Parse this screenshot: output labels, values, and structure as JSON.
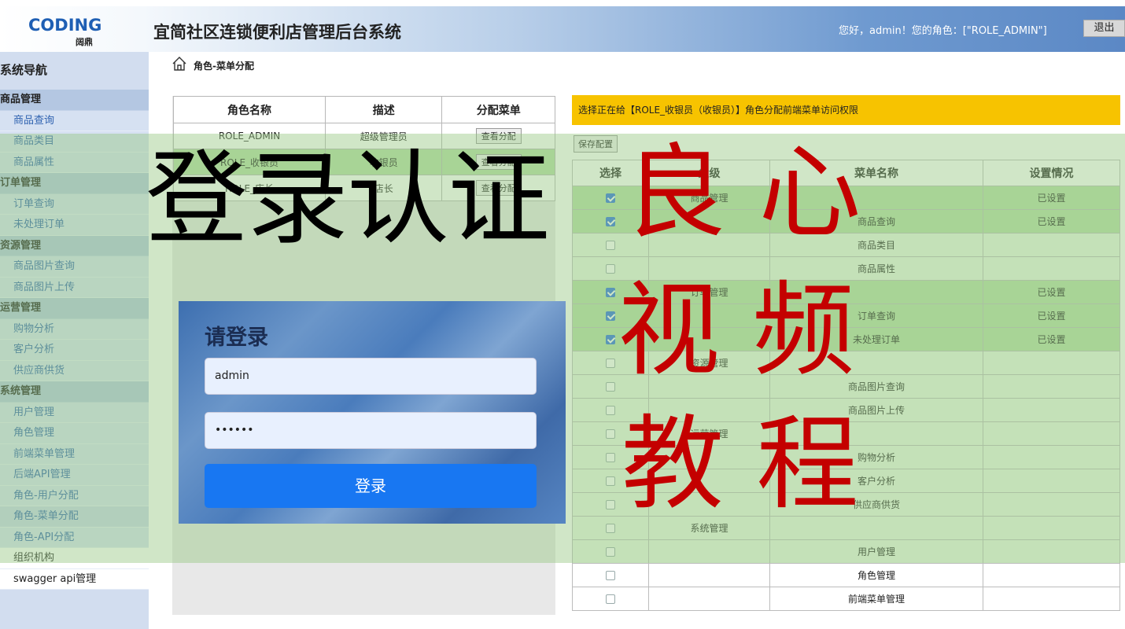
{
  "header": {
    "logo_main": "CODING",
    "logo_sub": "阔鼎",
    "title": "宜简社区连锁便利店管理后台系统",
    "user_info": "您好，admin！您的角色：[\"ROLE_ADMIN\"]",
    "logout_label": "退出"
  },
  "sidebar": {
    "title": "系统导航",
    "groups": [
      {
        "label": "商品管理",
        "items": [
          "商品查询",
          "商品类目",
          "商品属性"
        ]
      },
      {
        "label": "订单管理",
        "items": [
          "订单查询",
          "未处理订单"
        ]
      },
      {
        "label": "资源管理",
        "items": [
          "商品图片查询",
          "商品图片上传"
        ]
      },
      {
        "label": "运营管理",
        "items": [
          "购物分析",
          "客户分析",
          "供应商供货"
        ]
      },
      {
        "label": "系统管理",
        "items": [
          "用户管理",
          "角色管理",
          "前端菜单管理",
          "后端API管理",
          "角色-用户分配",
          "角色-菜单分配",
          "角色-API分配"
        ]
      }
    ],
    "extra_items": [
      "组织机构",
      "swagger api管理"
    ]
  },
  "breadcrumb": {
    "text": "角色-菜单分配"
  },
  "roles_table": {
    "headers": [
      "角色名称",
      "描述",
      "分配菜单"
    ],
    "rows": [
      {
        "name": "ROLE_ADMIN",
        "desc": "超级管理员",
        "action": "查看分配"
      },
      {
        "name": "ROLE_收银员",
        "desc": "收银员",
        "action": "查看分配"
      },
      {
        "name": "ROLE_店长",
        "desc": "店长",
        "action": "查看分配"
      }
    ]
  },
  "notice": "选择正在给【ROLE_收银员（收银员）】角色分配前端菜单访问权限",
  "save_label": "保存配置",
  "menu_table": {
    "headers": [
      "选择",
      "父级",
      "菜单名称",
      "设置情况"
    ],
    "rows": [
      {
        "checked": true,
        "parent": "商品管理",
        "name": "",
        "status": "已设置"
      },
      {
        "checked": true,
        "parent": "",
        "name": "商品查询",
        "status": "已设置"
      },
      {
        "checked": false,
        "parent": "",
        "name": "商品类目",
        "status": ""
      },
      {
        "checked": false,
        "parent": "",
        "name": "商品属性",
        "status": ""
      },
      {
        "checked": true,
        "parent": "订单管理",
        "name": "",
        "status": "已设置"
      },
      {
        "checked": true,
        "parent": "",
        "name": "订单查询",
        "status": "已设置"
      },
      {
        "checked": true,
        "parent": "",
        "name": "未处理订单",
        "status": "已设置"
      },
      {
        "checked": false,
        "parent": "资源管理",
        "name": "",
        "status": ""
      },
      {
        "checked": false,
        "parent": "",
        "name": "商品图片查询",
        "status": ""
      },
      {
        "checked": false,
        "parent": "",
        "name": "商品图片上传",
        "status": ""
      },
      {
        "checked": false,
        "parent": "运营管理",
        "name": "",
        "status": ""
      },
      {
        "checked": false,
        "parent": "",
        "name": "购物分析",
        "status": ""
      },
      {
        "checked": false,
        "parent": "",
        "name": "客户分析",
        "status": ""
      },
      {
        "checked": false,
        "parent": "",
        "name": "供应商供货",
        "status": ""
      },
      {
        "checked": false,
        "parent": "系统管理",
        "name": "",
        "status": ""
      },
      {
        "checked": false,
        "parent": "",
        "name": "用户管理",
        "status": ""
      },
      {
        "checked": false,
        "parent": "",
        "name": "角色管理",
        "status": ""
      },
      {
        "checked": false,
        "parent": "",
        "name": "前端菜单管理",
        "status": ""
      }
    ]
  },
  "login": {
    "title": "请登录",
    "username": "admin",
    "password_mask": "••••••",
    "button": "登录"
  },
  "overlay_text": {
    "black": "登录认证",
    "red1": "良 心",
    "red2": "视 频",
    "red3": "教 程"
  },
  "colors": {
    "accent_blue": "#1877f2",
    "notice_yellow": "#f7c300",
    "overlay_red": "#c40000",
    "set_row_green": "#b6dea6"
  }
}
